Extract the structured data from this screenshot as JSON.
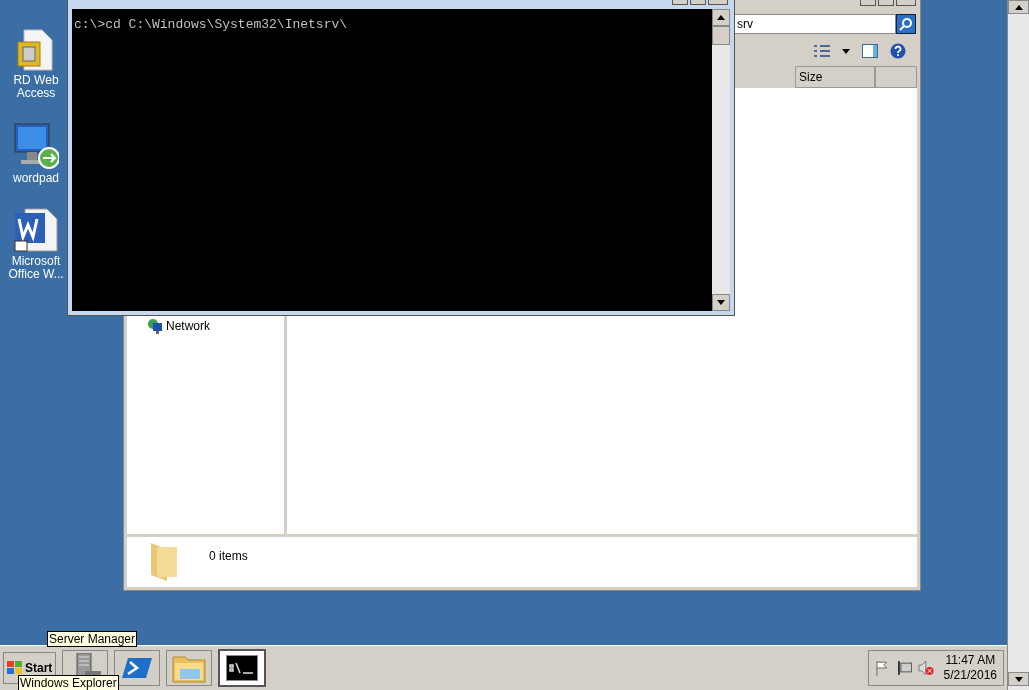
{
  "desktop_icons": [
    {
      "kind": "certificate",
      "label": "RD Web Access"
    },
    {
      "kind": "remote",
      "label": "wordpad"
    },
    {
      "kind": "word",
      "label": "Microsoft Office W..."
    }
  ],
  "explorer": {
    "search_value": "srv",
    "columns": [
      "Size"
    ],
    "nav_items": [
      {
        "label": "Network"
      }
    ],
    "status": "0 items"
  },
  "cmd": {
    "lines": [
      "c:\\>cd C:\\Windows\\System32\\Inetsrv\\"
    ]
  },
  "taskbar": {
    "start": "Start",
    "buttons": [
      {
        "kind": "server",
        "selected": false
      },
      {
        "kind": "powershell",
        "selected": false
      },
      {
        "kind": "folder",
        "selected": false
      },
      {
        "kind": "console",
        "selected": true
      }
    ],
    "tooltips": [
      "Server Manager",
      "Windows Explorer"
    ],
    "clock": {
      "time": "11:47 AM",
      "date": "5/21/2016"
    }
  }
}
